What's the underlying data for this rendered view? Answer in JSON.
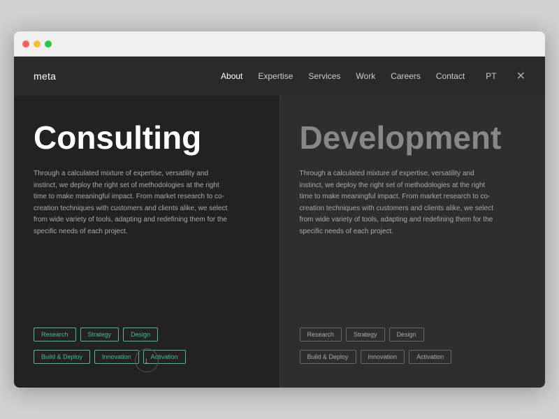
{
  "browser": {
    "dots": [
      "red",
      "yellow",
      "green"
    ]
  },
  "nav": {
    "logo": "meta",
    "links": [
      "About",
      "Expertise",
      "Services",
      "Work",
      "Careers",
      "Contact"
    ],
    "lang": "PT",
    "close_icon": "✕"
  },
  "panels": [
    {
      "id": "consulting",
      "title": "Consulting",
      "description": "Through a calculated mixture of expertise, versatility and instinct, we deploy the right set of methodologies at the right time to make meaningful impact. From market research to co-creation techniques with customers and clients alike, we select from wide variety of tools, adapting and redefining them for the specific needs of each project.",
      "tags_row1": [
        "Research",
        "Strategy",
        "Design"
      ],
      "tags_row2": [
        "Build & Deploy",
        "Innovation",
        "Activation"
      ]
    },
    {
      "id": "development",
      "title": "Development",
      "description": "Through a calculated mixture of expertise, versatility and instinct, we deploy the right set of methodologies at the right time to make meaningful impact. From market research to co-creation techniques with customers and clients alike, we select from wide variety of tools, adapting and redefining them for the specific needs of each project.",
      "tags_row1": [
        "Research",
        "Strategy",
        "Design"
      ],
      "tags_row2": [
        "Build & Deploy",
        "Innovation",
        "Activation"
      ]
    }
  ],
  "scroll_button": {
    "icon": "↓"
  }
}
